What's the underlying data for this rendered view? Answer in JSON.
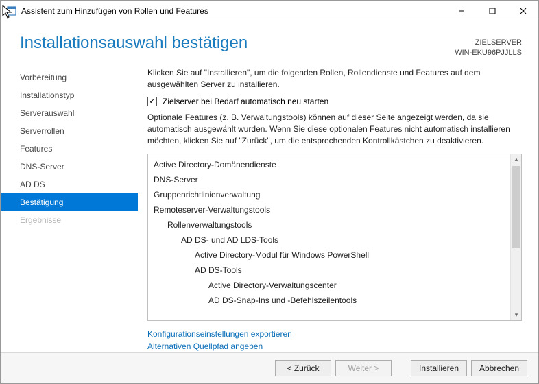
{
  "window": {
    "title": "Assistent zum Hinzufügen von Rollen und Features"
  },
  "header": {
    "heading": "Installationsauswahl bestätigen",
    "target_label": "ZIELSERVER",
    "target_value": "WIN-EKU96PJJLLS"
  },
  "sidebar": {
    "items": [
      {
        "label": "Vorbereitung",
        "name": "step-preparation",
        "selected": false,
        "disabled": false
      },
      {
        "label": "Installationstyp",
        "name": "step-installtype",
        "selected": false,
        "disabled": false
      },
      {
        "label": "Serverauswahl",
        "name": "step-serverselect",
        "selected": false,
        "disabled": false
      },
      {
        "label": "Serverrollen",
        "name": "step-serverroles",
        "selected": false,
        "disabled": false
      },
      {
        "label": "Features",
        "name": "step-features",
        "selected": false,
        "disabled": false
      },
      {
        "label": "DNS-Server",
        "name": "step-dnsserver",
        "selected": false,
        "disabled": false
      },
      {
        "label": "AD DS",
        "name": "step-adds",
        "selected": false,
        "disabled": false
      },
      {
        "label": "Bestätigung",
        "name": "step-confirmation",
        "selected": true,
        "disabled": false
      },
      {
        "label": "Ergebnisse",
        "name": "step-results",
        "selected": false,
        "disabled": true
      }
    ]
  },
  "content": {
    "intro": "Klicken Sie auf \"Installieren\", um die folgenden Rollen, Rollendienste und Features auf dem ausgewählten Server zu installieren.",
    "checkbox_label": "Zielserver bei Bedarf automatisch neu starten",
    "checkbox_checked": true,
    "optional": "Optionale Features (z. B. Verwaltungstools) können auf dieser Seite angezeigt werden, da sie automatisch ausgewählt wurden. Wenn Sie diese optionalen Features nicht automatisch installieren möchten, klicken Sie auf \"Zurück\", um die entsprechenden Kontrollkästchen zu deaktivieren.",
    "features": [
      {
        "text": "Active Directory-Domänendienste",
        "indent": 0
      },
      {
        "text": "DNS-Server",
        "indent": 0
      },
      {
        "text": "Gruppenrichtlinienverwaltung",
        "indent": 0
      },
      {
        "text": "Remoteserver-Verwaltungstools",
        "indent": 0
      },
      {
        "text": "Rollenverwaltungstools",
        "indent": 1
      },
      {
        "text": "AD DS- und AD LDS-Tools",
        "indent": 2
      },
      {
        "text": "Active Directory-Modul für Windows PowerShell",
        "indent": 3
      },
      {
        "text": "AD DS-Tools",
        "indent": 3
      },
      {
        "text": "Active Directory-Verwaltungscenter",
        "indent": 4
      },
      {
        "text": "AD DS-Snap-Ins und -Befehlszeilentools",
        "indent": 4
      }
    ],
    "links": {
      "export": "Konfigurationseinstellungen exportieren",
      "altpath": "Alternativen Quellpfad angeben"
    }
  },
  "footer": {
    "back": "< Zurück",
    "next": "Weiter >",
    "install": "Installieren",
    "cancel": "Abbrechen"
  }
}
